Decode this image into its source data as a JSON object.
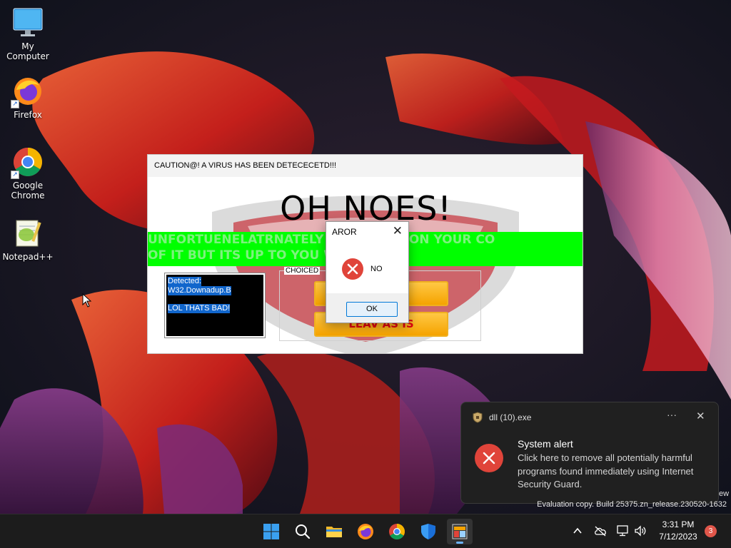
{
  "desktop": {
    "icons": [
      {
        "label": "My Computer",
        "icon": "monitor-icon"
      },
      {
        "label": "Firefox",
        "icon": "firefox-icon"
      },
      {
        "label": "Google Chrome",
        "icon": "chrome-icon"
      },
      {
        "label": "Notepad++",
        "icon": "notepadpp-icon"
      }
    ]
  },
  "virus_window": {
    "title": "CAUTION@! A VIRUS HAS BEEN DETECECETD!!!",
    "headline": "OH NOES!",
    "banner_line1": "UNFORTUENELATRNATELY            AV AV IRUS ON YOUR CO",
    "banner_line2": "OF IT BUT ITS UP TO YOU W                ???/",
    "detect_line1": "Detected:",
    "detect_line2": "W32.Downadup.B",
    "detect_line3": "LOL THATS BAD!",
    "choice_legend": "CHOICED",
    "button1_label": "R                      mnd)",
    "button2_label": "LEAV AS IS"
  },
  "error_dialog": {
    "title": "AROR",
    "close_glyph": "✕",
    "message": "NO",
    "ok_label": "OK"
  },
  "toast": {
    "app_name": "dll (10).exe",
    "more_glyph": "···",
    "close_glyph": "✕",
    "title": "System alert",
    "body": "Click here to remove all potentially harmful programs found immediately using Internet Security Guard."
  },
  "watermark": {
    "line_fragment": "ew",
    "line": "Evaluation copy. Build 25375.zn_release.230520-1632"
  },
  "taskbar": {
    "items": [
      "start-icon",
      "search-icon",
      "file-explorer-icon",
      "firefox-icon",
      "chrome-icon",
      "defender-icon",
      "virus-app-icon"
    ],
    "time": "3:31 PM",
    "date": "7/12/2023",
    "notification_count": "3"
  },
  "colors": {
    "banner_green": "#00ff00",
    "button_orange": "#f5a300",
    "error_red": "#e0443a",
    "toast_bg": "#202020",
    "taskbar_bg": "#1c1c1c"
  }
}
